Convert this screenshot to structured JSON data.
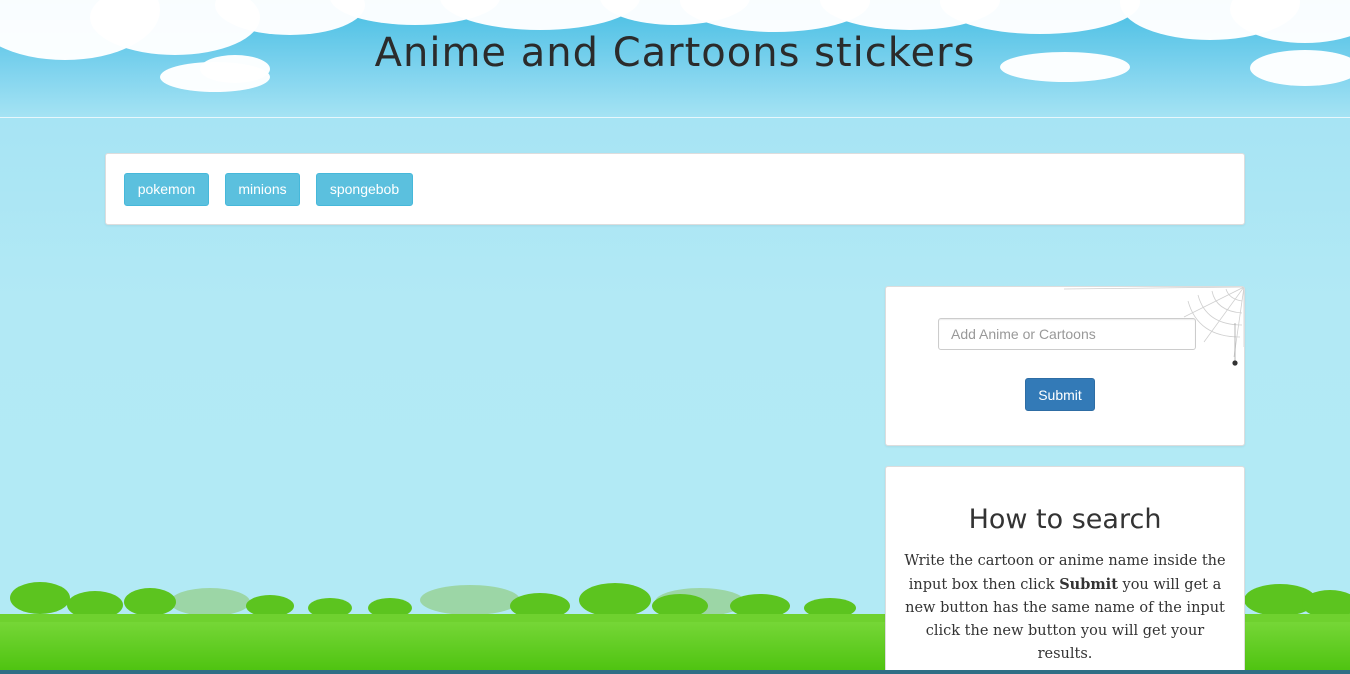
{
  "header": {
    "title": "Anime and Cartoons stickers"
  },
  "topics": {
    "buttons": [
      "pokemon",
      "minions",
      "spongebob"
    ]
  },
  "form": {
    "input_placeholder": "Add Anime or Cartoons",
    "input_value": "",
    "submit_label": "Submit"
  },
  "howto": {
    "title": "How to search",
    "text_before": "Write the cartoon or anime name inside the input box then click ",
    "text_bold": "Submit",
    "text_after": " you will get a new button has the same name of the input click the new button you will get your results."
  },
  "colors": {
    "topic_button": "#5bc0de",
    "submit_button": "#337ab7",
    "sky": "#b2e9f5",
    "grass": "#5ccf1c"
  }
}
